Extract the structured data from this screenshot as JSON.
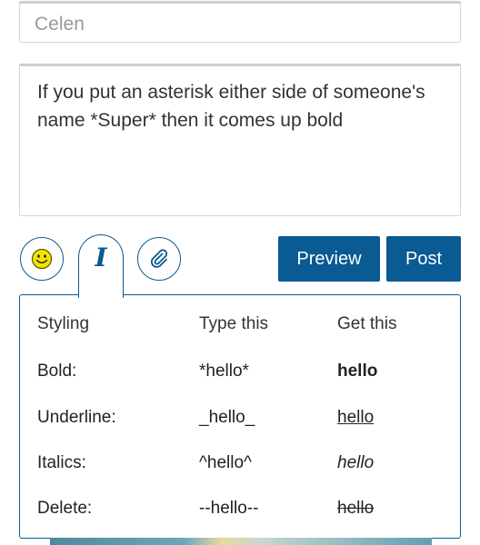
{
  "form": {
    "name_value": "Celen",
    "message_value": "If you put an asterisk either side of someone's name *Super* then it comes up bold"
  },
  "toolbar": {
    "emoji_icon": "smiley-icon",
    "italic_icon": "italic-icon",
    "italic_glyph": "I",
    "attach_icon": "paperclip-icon",
    "preview_label": "Preview",
    "post_label": "Post",
    "accent_color": "#0a5a93"
  },
  "styling_help": {
    "headers": [
      "Styling",
      "Type this",
      "Get this"
    ],
    "rows": [
      {
        "name": "Bold:",
        "input": "*hello*",
        "output": "hello",
        "style": "bold"
      },
      {
        "name": "Underline:",
        "input": "_hello_",
        "output": "hello",
        "style": "underline"
      },
      {
        "name": "Italics:",
        "input": "^hello^",
        "output": "hello",
        "style": "italic"
      },
      {
        "name": "Delete:",
        "input": "--hello--",
        "output": "hello",
        "style": "strikethrough"
      }
    ]
  }
}
